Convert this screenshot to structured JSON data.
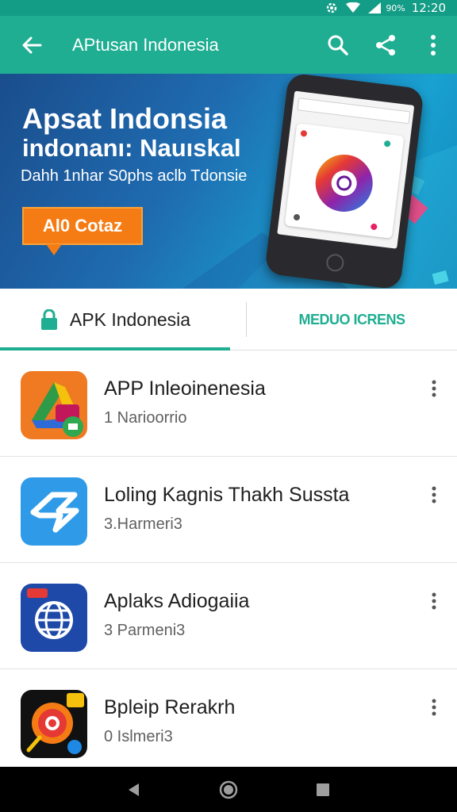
{
  "status_bar": {
    "battery_text": "90%",
    "time": "12:20",
    "icons": [
      "settings-icon",
      "wifi-icon",
      "signal-icon",
      "battery-icon"
    ]
  },
  "app_bar": {
    "title": "APtusan Indonesia",
    "color": "#1fae92",
    "icons": [
      "back-arrow-icon",
      "search-icon",
      "share-icon",
      "more-vert-icon"
    ]
  },
  "banner": {
    "title_line1": "Apsat Indonsia",
    "title_line2": "indonanı: Nauıskal",
    "subtitle": "Dahh 1nhar S0phs aclb Tdonsie",
    "cta_label": "Al0 Cotaz",
    "cta_color": "#f57c14"
  },
  "tabs": [
    {
      "label": "APK Indonesia",
      "icon": "lock-icon",
      "selected": true
    },
    {
      "label": "MEDUO ICRENS",
      "selected": false
    }
  ],
  "apps": [
    {
      "name": "APP Inleoinenesia",
      "subtitle": "1 Narioorrio",
      "icon": "drive-style-app-icon"
    },
    {
      "name": "Loling Kagnis Thakh Sussta",
      "subtitle": "3.Harmeri3",
      "icon": "arrow-logo-app-icon"
    },
    {
      "name": "Aplaks Adiogaiia",
      "subtitle": "3 Parmeni3",
      "icon": "globe-app-icon"
    },
    {
      "name": "Bpleip Rerakrh",
      "subtitle": "0 Islmeri3",
      "icon": "record-app-icon"
    }
  ],
  "nav_bar": {
    "icons": [
      "nav-back-icon",
      "nav-home-icon",
      "nav-recents-icon"
    ]
  }
}
